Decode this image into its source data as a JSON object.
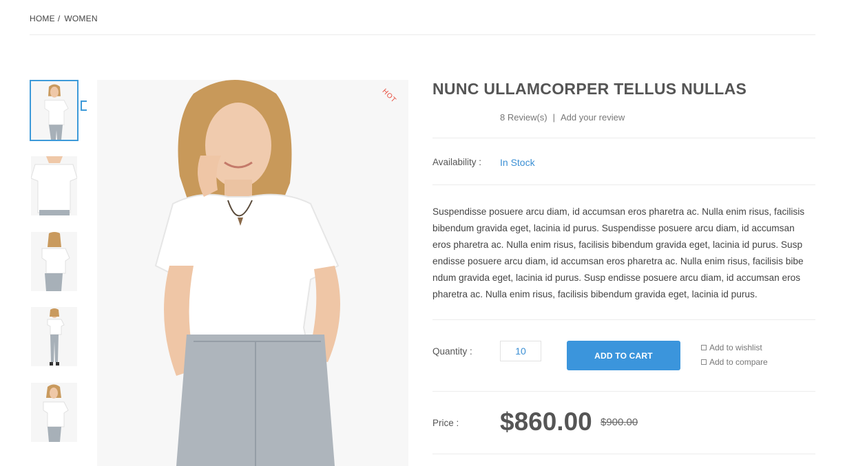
{
  "breadcrumb": {
    "home": "HOME",
    "separator": "/",
    "current": "WOMEN"
  },
  "gallery": {
    "thumbnails": [
      "model-front-thumb",
      "tshirt-closeup-thumb",
      "model-back-thumb",
      "model-full-thumb",
      "model-front-thumb-2"
    ],
    "badge": "HOT"
  },
  "product": {
    "title": "NUNC ULLAMCORPER TELLUS NULLAS",
    "reviews_count": "8 Review(s)",
    "reviews_divider": "|",
    "add_review": "Add your review",
    "availability_label": "Availability :",
    "availability_value": "In Stock",
    "description": "Suspendisse posuere arcu diam, id accumsan eros pharetra ac. Nulla enim risus, facilisis bibendum gravida eget, lacinia id purus. Suspendisse posuere arcu diam, id accumsan eros pharetra ac. Nulla enim risus, facilisis bibendum gravida eget, lacinia id purus. Susp endisse posuere arcu diam, id accumsan eros pharetra ac. Nulla enim risus, facilisis bibe ndum gravida eget, lacinia id purus. Susp endisse posuere arcu diam, id accumsan eros pharetra ac. Nulla enim risus, facilisis bibendum gravida eget, lacinia id purus.",
    "quantity_label": "Quantity :",
    "quantity_value": "10",
    "add_to_cart": "ADD TO CART",
    "wishlist": "Add to wishlist",
    "compare": "Add to compare",
    "price_label": "Price :",
    "price": "$860.00",
    "old_price": "$900.00"
  },
  "colors": {
    "accent": "#3b95dc",
    "hot": "#e74c3c",
    "stock": "#3b8fd4"
  }
}
